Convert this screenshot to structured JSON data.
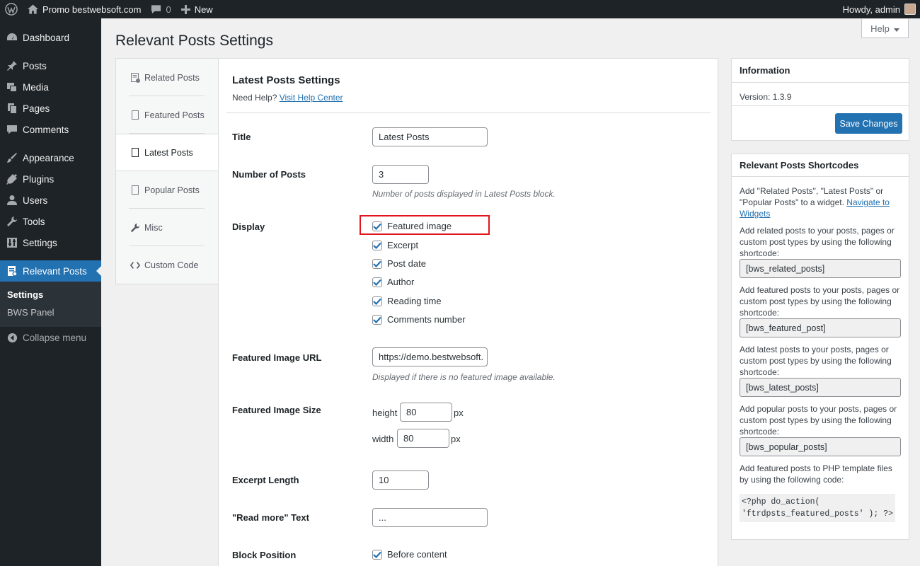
{
  "adminbar": {
    "site_name": "Promo bestwebsoft.com",
    "comments_count": "0",
    "new_label": "New",
    "howdy": "Howdy, admin"
  },
  "sidebar": {
    "items": [
      {
        "label": "Dashboard",
        "icon": "dashboard-icon"
      },
      {
        "label": "Posts",
        "icon": "pin-icon"
      },
      {
        "label": "Media",
        "icon": "media-icon"
      },
      {
        "label": "Pages",
        "icon": "pages-icon"
      },
      {
        "label": "Comments",
        "icon": "comment-icon"
      },
      {
        "label": "Appearance",
        "icon": "brush-icon"
      },
      {
        "label": "Plugins",
        "icon": "plugin-icon"
      },
      {
        "label": "Users",
        "icon": "user-icon"
      },
      {
        "label": "Tools",
        "icon": "wrench-icon"
      },
      {
        "label": "Settings",
        "icon": "settings-icon"
      },
      {
        "label": "Relevant Posts",
        "icon": "relevant-posts-icon"
      }
    ],
    "submenu": [
      "Settings",
      "BWS Panel"
    ],
    "collapse": "Collapse menu"
  },
  "page": {
    "title": "Relevant Posts Settings",
    "help_label": "Help"
  },
  "tabs": [
    {
      "label": "Related Posts"
    },
    {
      "label": "Featured Posts"
    },
    {
      "label": "Latest Posts"
    },
    {
      "label": "Popular Posts"
    },
    {
      "label": "Misc"
    },
    {
      "label": "Custom Code"
    }
  ],
  "panel": {
    "title": "Latest Posts Settings",
    "need_help": "Need Help?",
    "help_link": "Visit Help Center",
    "fields": {
      "title": {
        "label": "Title",
        "value": "Latest Posts"
      },
      "number": {
        "label": "Number of Posts",
        "value": "3",
        "desc": "Number of posts displayed in Latest Posts block."
      },
      "display": {
        "label": "Display",
        "options": [
          "Featured image",
          "Excerpt",
          "Post date",
          "Author",
          "Reading time",
          "Comments number"
        ]
      },
      "image_url": {
        "label": "Featured Image URL",
        "value": "https://demo.bestwebsoft.",
        "desc": "Displayed if there is no featured image available."
      },
      "image_size": {
        "label": "Featured Image Size",
        "height_label": "height",
        "height": "80",
        "width_label": "width",
        "width": "80",
        "unit": "px"
      },
      "excerpt": {
        "label": "Excerpt Length",
        "value": "10"
      },
      "read_more": {
        "label": "\"Read more\" Text",
        "value": "..."
      },
      "position": {
        "label": "Block Position",
        "option": "Before content"
      }
    }
  },
  "info": {
    "title": "Information",
    "version": "Version: 1.3.9",
    "save": "Save Changes"
  },
  "shortcodes": {
    "title": "Relevant Posts Shortcodes",
    "intro": "Add \"Related Posts\", \"Latest Posts\" or \"Popular Posts\" to a widget.",
    "intro_link": "Navigate to Widgets",
    "related_text": "Add related posts to your posts, pages or custom post types by using the following shortcode:",
    "related_code": "[bws_related_posts]",
    "featured_text": "Add featured posts to your posts, pages or custom post types by using the following shortcode:",
    "featured_code": "[bws_featured_post]",
    "latest_text": "Add latest posts to your posts, pages or custom post types by using the following shortcode:",
    "latest_code": "[bws_latest_posts]",
    "popular_text": "Add popular posts to your posts, pages or custom post types by using the following shortcode:",
    "popular_code": "[bws_popular_posts]",
    "php_text": "Add featured posts to PHP template files by using the following code:",
    "php_code_1": "<?php do_action(",
    "php_code_2": "'ftrdpsts_featured_posts' ); ?>"
  }
}
